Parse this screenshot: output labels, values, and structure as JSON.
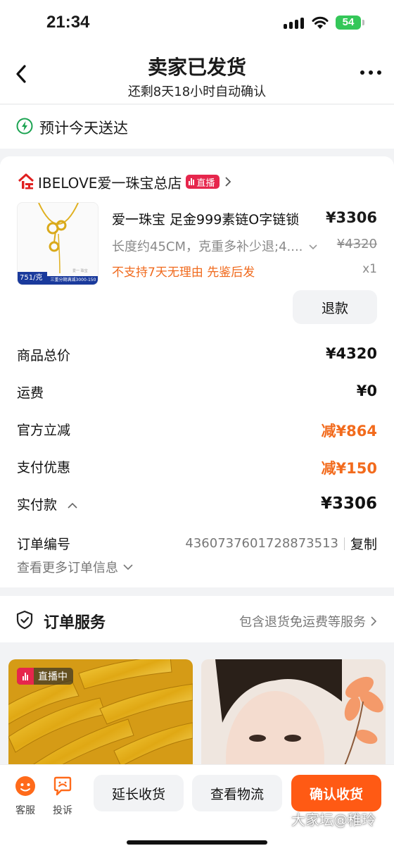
{
  "status_bar": {
    "time": "21:34",
    "battery": "54"
  },
  "header": {
    "title": "卖家已发货",
    "subtitle": "还剩8天18小时自动确认"
  },
  "delivery": {
    "eta_text": "预计今天送达"
  },
  "shop": {
    "name": "IBELOVE爱一珠宝总店",
    "live_label": "直播"
  },
  "product": {
    "name": "爱一珠宝 足金999素链O字链锁",
    "price": "¥3306",
    "spec": "长度约45CM，克重多补少退;4....",
    "original_price": "¥4320",
    "note": "不支持7天无理由  先鉴后发",
    "quantity": "x1",
    "thumb_price_tag": "751/克起",
    "thumb_promo": "三重分期满减3000-150",
    "refund_button": "退款"
  },
  "summary": {
    "rows": [
      {
        "label": "商品总价",
        "value": "¥4320"
      },
      {
        "label": "运费",
        "value": "¥0"
      },
      {
        "label": "官方立减",
        "value": "减¥864"
      },
      {
        "label": "支付优惠",
        "value": "减¥150"
      },
      {
        "label": "实付款",
        "value": "¥3306"
      }
    ],
    "order_label": "订单编号",
    "order_number": "4360737601728873513",
    "copy_label": "复制",
    "more_info": "查看更多订单信息"
  },
  "service": {
    "title": "订单服务",
    "desc": "包含退货免运费等服务"
  },
  "feed": {
    "live_label": "直播中"
  },
  "bottom_bar": {
    "kefu_label": "客服",
    "complaint_label": "投诉",
    "extend_button": "延长收货",
    "logistics_button": "查看物流",
    "confirm_button": "确认收货"
  },
  "watermark": "大家坛@稚玲",
  "colors": {
    "accent": "#ff5a14",
    "discount": "#f26b1d",
    "live": "#e6264c",
    "eta": "#1ba351"
  }
}
